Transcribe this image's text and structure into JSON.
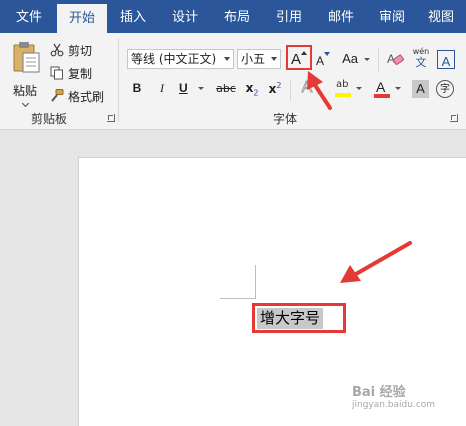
{
  "tabs": [
    "文件",
    "开始",
    "插入",
    "设计",
    "布局",
    "引用",
    "邮件",
    "审阅",
    "视图"
  ],
  "active_tab": "开始",
  "clipboard": {
    "paste_label": "粘贴",
    "cut_label": "剪切",
    "copy_label": "复制",
    "format_painter_label": "格式刷",
    "group_label": "剪贴板"
  },
  "font": {
    "font_name": "等线 (中文正文)",
    "font_size": "小五",
    "grow_font": "A",
    "shrink_font": "A",
    "change_case": "Aa",
    "phonetic_top": "wén",
    "phonetic_bottom": "文",
    "char_border": "A",
    "bold": "B",
    "italic": "I",
    "underline": "U",
    "strikethrough": "abc",
    "subscript_base": "x",
    "subscript_sub": "2",
    "superscript_base": "x",
    "superscript_sup": "2",
    "text_effects": "A",
    "highlight": "ab",
    "font_color": "A",
    "char_shading": "A",
    "enclose_char": "字",
    "group_label": "字体"
  },
  "document": {
    "selected_text": "增大字号"
  },
  "watermark": {
    "line1": "Bai 经验",
    "line2": "jingyan.baidu.com"
  },
  "colors": {
    "ribbon_blue": "#2b579a",
    "annotation_red": "#e53935",
    "font_color_red": "#e53935",
    "highlight_yellow": "#fff200"
  }
}
